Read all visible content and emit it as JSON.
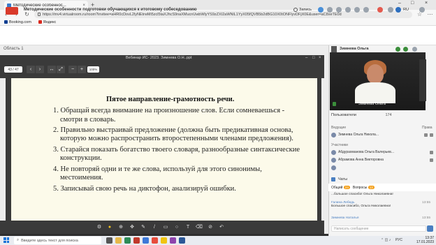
{
  "browser": {
    "tab_title": "Методические особеннос...",
    "tab_close": "×",
    "new_tab": "+",
    "window_controls": [
      "–",
      "□",
      "×"
    ],
    "url": "https://mv4.virtualroom.ru/room?invitee=aHR0cDovL2lyNEtrwMi5zcl5taXJhcS9naXMucnUwbWlyYS9zZXI2aWNlL1YyX05fQVB5b2dBG10X0tONFlyvDFjX0E&user=aC8xeTE0d",
    "bookmarks": [
      {
        "label": "Booking.com",
        "icon": "booking-icon",
        "color": "#0b3d91"
      },
      {
        "label": "Яндекс",
        "icon": "yandex-icon",
        "color": "#d9281d"
      }
    ]
  },
  "app": {
    "title": "Методические особенности подготовки обучающихся к итоговому собеседованию",
    "record_label": "Запись",
    "language": "RU",
    "area_label": "Область 1",
    "presentation_title": "Вебинар ИС- 2023. Зимнева О.Н..ppt",
    "page_indicator": "43 / 47",
    "zoom": "100%"
  },
  "slide": {
    "title": "Пятое направление-грамотность речи.",
    "lines": [
      "1. Обращай всегда внимание на произношение слов. Если сомневаешься -",
      "смотри в словарь.",
      "2. Правильно выстраивай предложение (должна быть предикативная основа,",
      "которую можно распространить второстепенными членами предложения).",
      "3. Старайся показать богатство твоего словаря, разнообразные синтаксические",
      "конструкции.",
      "4. Не повторяй одни и те же слова, используй для этого синонимы,",
      "местоимения.",
      "5. Записывай свою речь на диктофон, анализируй ошибки."
    ]
  },
  "right": {
    "speaker_small": "Зимнева Ольга",
    "video_name": "Зимнева Ольга",
    "users_header": "Пользователи",
    "users_count": "174",
    "section_hosts": "Ведущие",
    "rights_label": "Права",
    "hosts": [
      "Зимнева Ольга Никола..."
    ],
    "section_participants": "Участники",
    "participants": [
      "Абдурахманова Ольга Валерьев...",
      "Абрамова Анна Викторовна",
      "",
      "",
      ""
    ],
    "chats_label": "Чаты",
    "chat_tabs": [
      {
        "label": "Общий",
        "badge": "24"
      },
      {
        "label": "Вопросы",
        "badge": "13"
      }
    ],
    "messages": [
      {
        "who": "",
        "text": "...большое спасибо! Ольга Николаевна!",
        "time": ""
      },
      {
        "who": "Галина Лебедь",
        "text": "Большое спасибо, Ольга Николаевна!",
        "time": "13:55"
      },
      {
        "who": "Зимнева Наталья",
        "text": "",
        "time": "13:55"
      }
    ],
    "input_placeholder": "Написать сообщение"
  },
  "taskbar": {
    "search_placeholder": "Введите здесь текст для поиска",
    "tray_lang": "РУС",
    "time": "13:37",
    "date": "17.01.2023"
  }
}
